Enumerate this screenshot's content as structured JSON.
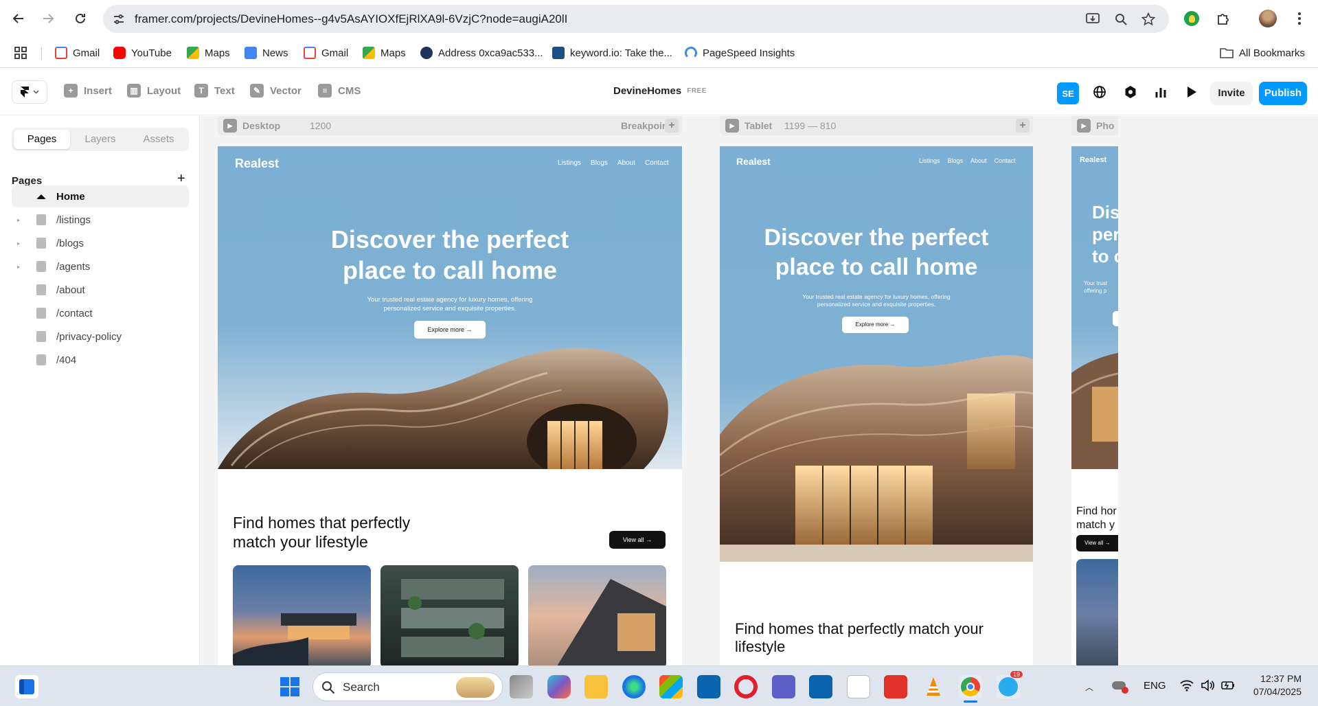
{
  "browser": {
    "url": "framer.com/projects/DevineHomes--g4v5AsAYIOXfEjRlXA9l-6VzjC?node=augiA20lI",
    "bookmarks": [
      {
        "label": "Gmail",
        "color": "#ea4335"
      },
      {
        "label": "YouTube",
        "color": "#ff0000"
      },
      {
        "label": "Maps",
        "color": "#34a853"
      },
      {
        "label": "News",
        "color": "#4285f4"
      },
      {
        "label": "Gmail",
        "color": "#ea4335"
      },
      {
        "label": "Maps",
        "color": "#34a853"
      },
      {
        "label": "Address 0xca9ac533...",
        "color": "#21325b"
      },
      {
        "label": "keyword.io: Take the...",
        "color": "#1c4f82"
      },
      {
        "label": "PageSpeed Insights",
        "color": "#4285f4"
      }
    ],
    "all_bookmarks": "All Bookmarks"
  },
  "framer": {
    "tools": [
      "Insert",
      "Layout",
      "Text",
      "Vector",
      "CMS"
    ],
    "project_name": "DevineHomes",
    "plan_badge": "FREE",
    "avatar_initials": "SE",
    "invite_label": "Invite",
    "publish_label": "Publish",
    "accent": "#0099ff"
  },
  "sidebar": {
    "tabs": [
      "Pages",
      "Layers",
      "Assets"
    ],
    "section_title": "Pages",
    "pages": [
      {
        "label": "Home",
        "active": true,
        "expandable": false
      },
      {
        "label": "/listings",
        "active": false,
        "expandable": true
      },
      {
        "label": "/blogs",
        "active": false,
        "expandable": true
      },
      {
        "label": "/agents",
        "active": false,
        "expandable": true
      },
      {
        "label": "/about",
        "active": false,
        "expandable": false
      },
      {
        "label": "/contact",
        "active": false,
        "expandable": false
      },
      {
        "label": "/privacy-policy",
        "active": false,
        "expandable": false
      },
      {
        "label": "/404",
        "active": false,
        "expandable": false
      }
    ]
  },
  "canvas": {
    "desktop_bar": {
      "name": "Desktop",
      "size": "1200",
      "breakpoint": "Breakpoint"
    },
    "tablet_bar": {
      "name": "Tablet",
      "size": "1199 — 810"
    },
    "phone_bar": {
      "name": "Pho"
    },
    "site": {
      "logo": "Realest",
      "nav": [
        "Listings",
        "Blogs",
        "About",
        "Contact"
      ],
      "hero_line1": "Discover the perfect",
      "hero_line2": "place to call home",
      "hero_sub_line1": "Your trusted real estate agency for luxury homes, offering",
      "hero_sub_line2": "personalized service and exquisite properties.",
      "explore": "Explore more",
      "section_line1": "Find homes that perfectly",
      "section_line2": "match your lifestyle",
      "section_tablet_line1": "Find homes that perfectly match your",
      "section_tablet_line2": "lifestyle",
      "view_all": "View all",
      "phone_hero": [
        "Dis",
        "per",
        "to c"
      ],
      "phone_sub": [
        "Your trust",
        "offering p"
      ],
      "phone_section": [
        "Find hor",
        "match y"
      ]
    }
  },
  "taskbar": {
    "search": "Search",
    "language": "ENG",
    "time": "12:37 PM",
    "date": "07/04/2025",
    "telegram_badge": "19"
  }
}
